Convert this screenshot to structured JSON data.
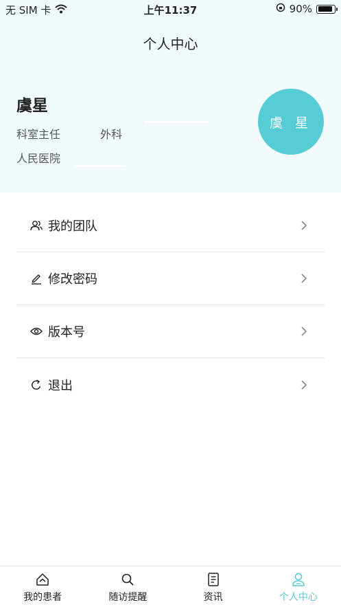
{
  "status_bar": {
    "carrier": "无 SIM 卡",
    "time": "上午11:37",
    "battery_percent": "90%",
    "battery_level": 0.9
  },
  "header": {
    "title": "个人中心",
    "user": {
      "name": "虞星",
      "position": "科室主任",
      "department": "外科",
      "hospital": "人民医院",
      "avatar_text": "虞 星"
    }
  },
  "menu": {
    "items": [
      {
        "label": "我的团队",
        "icon": "team-icon"
      },
      {
        "label": "修改密码",
        "icon": "edit-icon"
      },
      {
        "label": "版本号",
        "icon": "eye-icon"
      },
      {
        "label": "退出",
        "icon": "refresh-icon"
      }
    ]
  },
  "tabbar": {
    "tabs": [
      {
        "label": "我的患者",
        "icon": "home-icon"
      },
      {
        "label": "随访提醒",
        "icon": "search-icon"
      },
      {
        "label": "资讯",
        "icon": "document-icon"
      },
      {
        "label": "个人中心",
        "icon": "user-icon",
        "active": true
      }
    ]
  },
  "colors": {
    "accent": "#56ccd6",
    "header_bg": "#f2fbfc",
    "divider": "#e6e6e6"
  }
}
